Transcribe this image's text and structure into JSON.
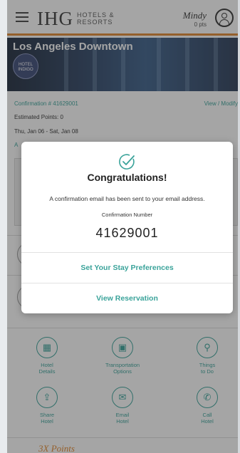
{
  "header": {
    "logo_main": "IHG",
    "logo_sub_line1": "HOTELS &",
    "logo_sub_line2": "RESORTS",
    "user_name": "Mindy",
    "user_points": "0 pts"
  },
  "hero": {
    "hotel_name": "Los Angeles Downtown",
    "badge_text": "HOTEL INDIGO"
  },
  "reservation": {
    "confirmation_line": "Confirmation # 41629001",
    "view_modify": "View / Modify",
    "estimated_points": "Estimated Points: 0",
    "dates": "Thu, Jan 06 - Sat, Jan 08",
    "partial_letter": "A"
  },
  "icon_grid": [
    {
      "label_line1": "Hotel",
      "label_line2": "Details",
      "icon": "hotel-building-icon"
    },
    {
      "label_line1": "Transportation",
      "label_line2": "Options",
      "icon": "bus-icon"
    },
    {
      "label_line1": "Things",
      "label_line2": "to Do",
      "icon": "bicycle-icon"
    },
    {
      "label_line1": "Share",
      "label_line2": "Hotel",
      "icon": "share-icon"
    },
    {
      "label_line1": "Email",
      "label_line2": "Hotel",
      "icon": "email-icon"
    },
    {
      "label_line1": "Call",
      "label_line2": "Hotel",
      "icon": "phone-icon"
    }
  ],
  "bottom": {
    "promo_title": "3X Points"
  },
  "modal": {
    "title": "Congratulations!",
    "message": "A confirmation email has been sent to your email address.",
    "conf_label": "Confirmation Number",
    "conf_number": "41629001",
    "btn_preferences": "Set Your Stay Preferences",
    "btn_view": "View Reservation"
  },
  "colors": {
    "accent_teal": "#3aa39a",
    "accent_orange": "#e4892f"
  }
}
